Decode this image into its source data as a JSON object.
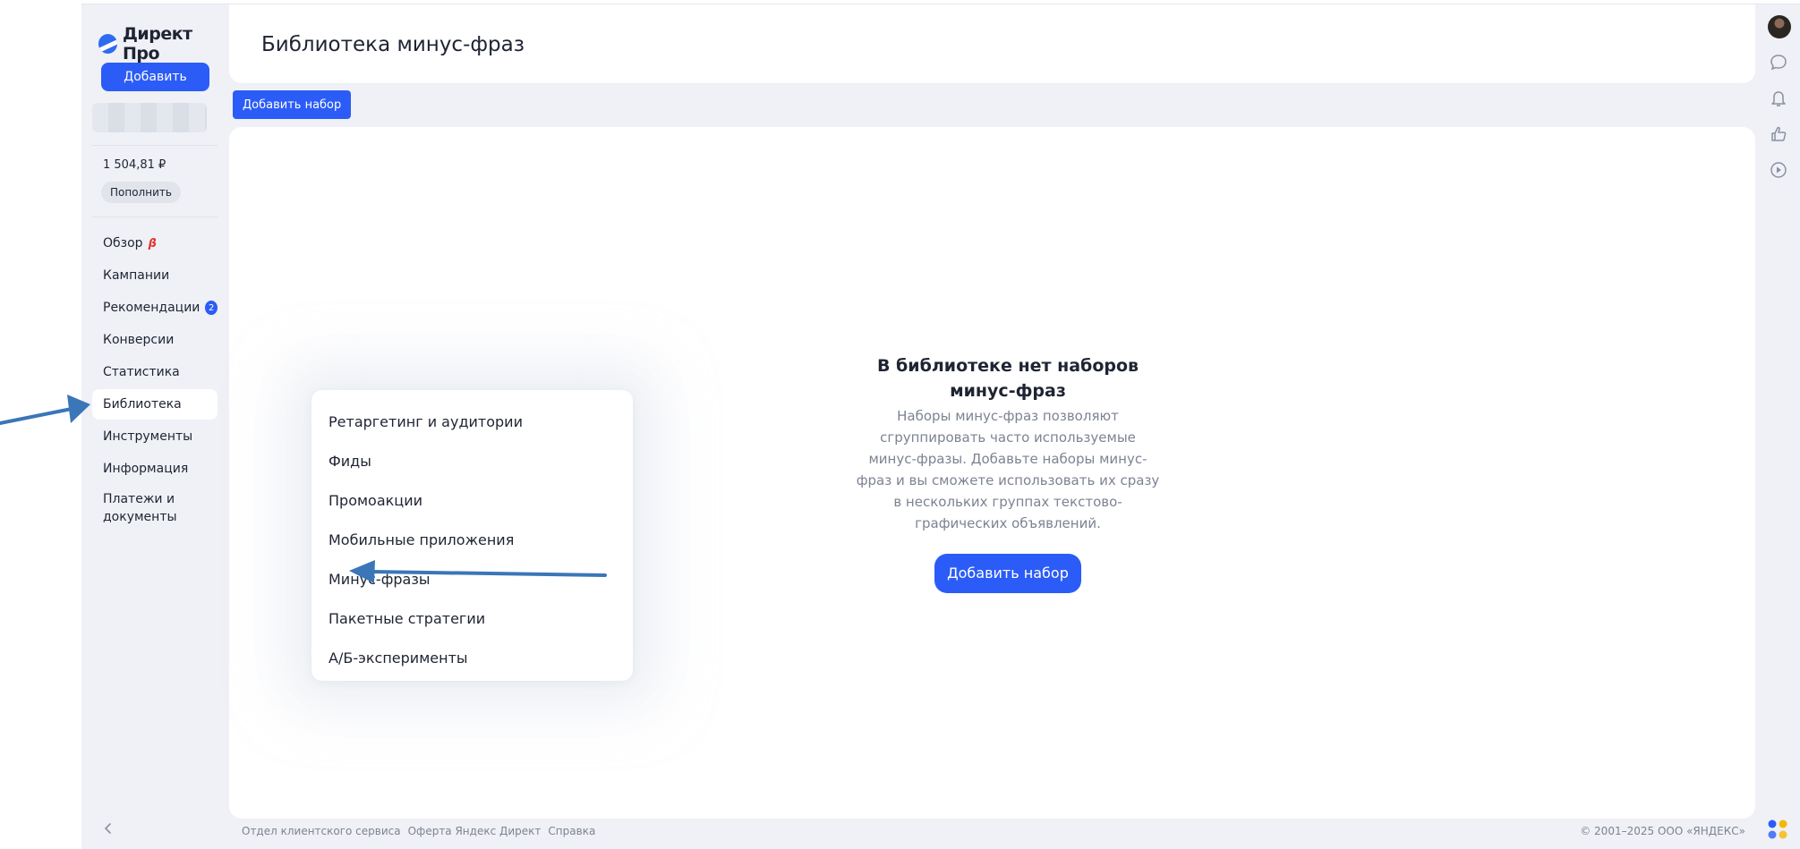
{
  "brand": {
    "name": "Директ Про"
  },
  "sidebar": {
    "add_label": "Добавить",
    "balance": "1 504,81 ₽",
    "topup_label": "Пополнить",
    "items": [
      {
        "label": "Обзор",
        "beta": "β"
      },
      {
        "label": "Кампании"
      },
      {
        "label": "Рекомендации",
        "badge": "2"
      },
      {
        "label": "Конверсии"
      },
      {
        "label": "Статистика"
      },
      {
        "label": "Библиотека",
        "active": true
      },
      {
        "label": "Инструменты"
      },
      {
        "label": "Информация"
      },
      {
        "label": "Платежи и документы"
      }
    ]
  },
  "header": {
    "title": "Библиотека минус-фраз"
  },
  "toolbar": {
    "add_set_label": "Добавить набор"
  },
  "empty_state": {
    "title": "В библиотеке нет наборов минус-фраз",
    "text": "Наборы минус-фраз позволяют сгруппировать часто используемые минус-фразы. Добавьте наборы минус-фраз и вы сможете использовать их сразу в нескольких группах текстово-графических объявлений.",
    "button_label": "Добавить набор"
  },
  "submenu": {
    "items": [
      "Ретаргетинг и аудитории",
      "Фиды",
      "Промоакции",
      "Мобильные приложения",
      "Минус-фразы",
      "Пакетные стратегии",
      "А/Б-эксперименты"
    ]
  },
  "footer": {
    "links": [
      "Отдел клиентского сервиса",
      "Оферта Яндекс Директ",
      "Справка"
    ],
    "copyright": "© 2001–2025 ООО «ЯНДЕКС»"
  },
  "colors": {
    "accent": "#2b5cf7",
    "annotation_arrow": "#3a76b8",
    "background": "#eff1f6"
  }
}
